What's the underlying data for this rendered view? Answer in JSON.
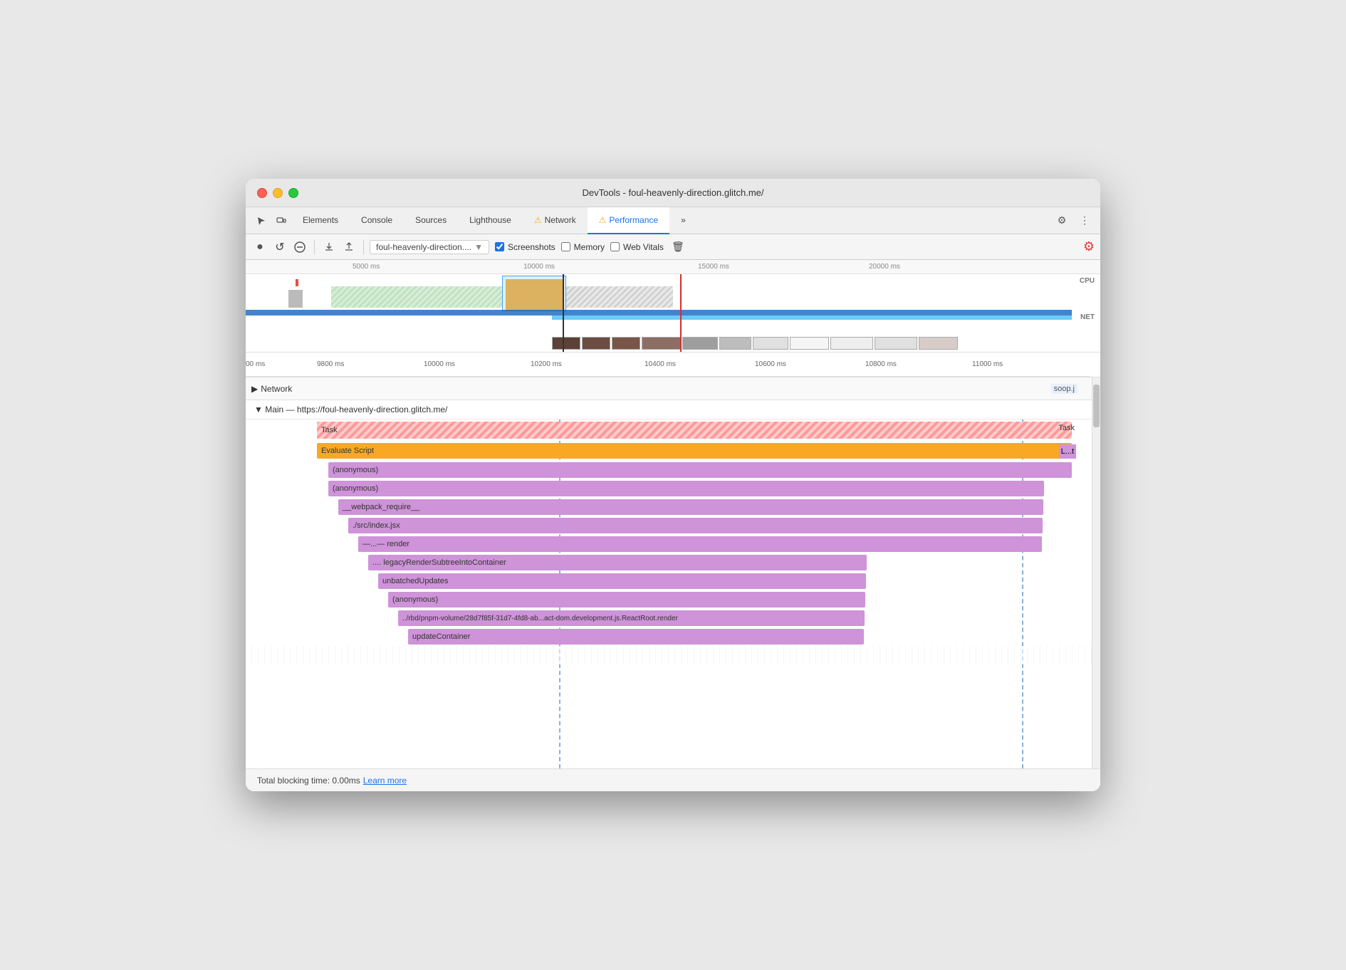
{
  "window": {
    "title": "DevTools - foul-heavenly-direction.glitch.me/"
  },
  "tabs": [
    {
      "id": "cursor",
      "label": "",
      "icon": "cursor-icon",
      "active": false
    },
    {
      "id": "device",
      "label": "",
      "icon": "device-icon",
      "active": false
    },
    {
      "id": "elements",
      "label": "Elements",
      "active": false
    },
    {
      "id": "console",
      "label": "Console",
      "active": false
    },
    {
      "id": "sources",
      "label": "Sources",
      "active": false
    },
    {
      "id": "lighthouse",
      "label": "Lighthouse",
      "active": false
    },
    {
      "id": "network",
      "label": "Network",
      "active": false,
      "warning": true
    },
    {
      "id": "performance",
      "label": "Performance",
      "active": true,
      "warning": true
    },
    {
      "id": "more",
      "label": "»",
      "active": false
    }
  ],
  "toolbar": {
    "record_label": "●",
    "reload_label": "↺",
    "clear_label": "🚫",
    "upload_label": "⬆",
    "download_label": "⬇",
    "url_value": "foul-heavenly-direction....",
    "screenshots_label": "Screenshots",
    "memory_label": "Memory",
    "web_vitals_label": "Web Vitals",
    "trash_label": "🗑",
    "settings_label": "⚙",
    "more_label": "⋮"
  },
  "timeline": {
    "ruler_marks": [
      "5000 ms",
      "10000 ms",
      "15000 ms",
      "20000 ms"
    ],
    "zoom_marks": [
      "00 ms",
      "9800 ms",
      "10000 ms",
      "10200 ms",
      "10400 ms",
      "10600 ms",
      "10800 ms",
      "11000 ms"
    ],
    "cpu_label": "CPU",
    "net_label": "NET"
  },
  "network_section": {
    "toggle_icon": "▶",
    "label": "Network",
    "file_ref": "soop.j"
  },
  "main": {
    "thread_label": "▼ Main — https://foul-heavenly-direction.glitch.me/",
    "rows": [
      {
        "id": "task",
        "label": "Task",
        "right_label": "Task",
        "type": "task"
      },
      {
        "id": "evaluate-script",
        "label": "Evaluate Script",
        "right_label": "L...t",
        "type": "evaluate-script"
      },
      {
        "id": "anonymous1",
        "label": "(anonymous)",
        "type": "anonymous1"
      },
      {
        "id": "anonymous2",
        "label": "(anonymous)",
        "type": "anonymous2"
      },
      {
        "id": "webpack",
        "label": "__webpack_require__",
        "type": "webpack"
      },
      {
        "id": "src-index",
        "label": "./src/index.jsx",
        "type": "src-index"
      },
      {
        "id": "render1",
        "label": "—...—  render",
        "type": "render1"
      },
      {
        "id": "legacy-render",
        "label": "....  legacyRenderSubtreeIntoContainer",
        "type": "legacy-render"
      },
      {
        "id": "unbatched",
        "label": "unbatchedUpdates",
        "type": "unbatched"
      },
      {
        "id": "anonymous3",
        "label": "(anonymous)",
        "type": "anonymous3"
      },
      {
        "id": "rbd",
        "label": "../rbd/pnpm-volume/28d7f85f-31d7-4fd8-ab...act-dom.development.js.ReactRoot.render",
        "type": "rbd"
      },
      {
        "id": "update-container",
        "label": "updateContainer",
        "type": "update-container"
      }
    ]
  },
  "status_bar": {
    "total_blocking_time": "Total blocking time: 0.00ms",
    "learn_more": "Learn more"
  }
}
